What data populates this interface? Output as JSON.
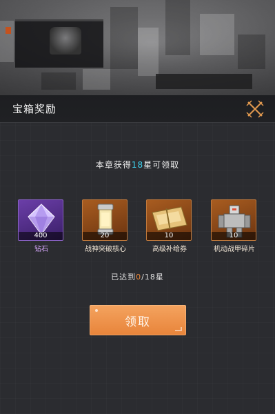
{
  "dialog": {
    "title": "宝箱奖励",
    "progress_prefix": "本章获得",
    "progress_stars": "18",
    "progress_suffix": "星可领取",
    "reached_prefix": "已达到",
    "reached_current": "0",
    "reached_suffix": "/18星",
    "claim_label": "领取"
  },
  "rewards": [
    {
      "name": "钻石",
      "count": "400",
      "icon": "diamond-icon",
      "rarity": "purple"
    },
    {
      "name": "战神突破核心",
      "count": "20",
      "icon": "core-canister-icon",
      "rarity": "orange"
    },
    {
      "name": "高级补给券",
      "count": "10",
      "icon": "supply-ticket-icon",
      "rarity": "orange"
    },
    {
      "name": "机动战甲碎片",
      "count": "10",
      "icon": "mech-fragment-icon",
      "rarity": "orange"
    }
  ],
  "colors": {
    "highlight_cyan": "#3fd3f0",
    "highlight_orange": "#f08a3a",
    "button": "#e8843a",
    "purple_frame": "#8a62c6",
    "orange_frame": "#c27a3c"
  }
}
